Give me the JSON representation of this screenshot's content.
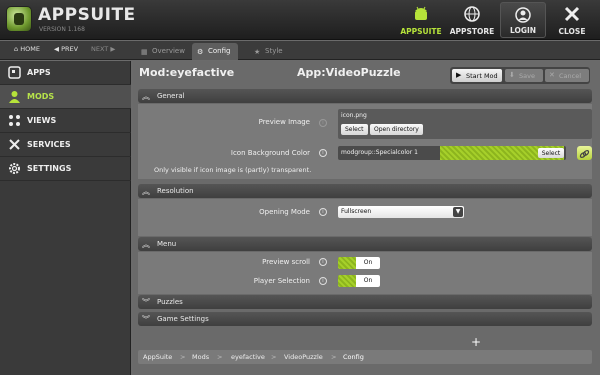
{
  "app": {
    "title": "APPSUITE",
    "version": "VERSION 1.168"
  },
  "top_buttons": [
    {
      "label": "APPSUITE",
      "icon": "android-icon"
    },
    {
      "label": "APPSTORE",
      "icon": "globe-icon"
    },
    {
      "label": "LOGIN",
      "icon": "user-icon"
    },
    {
      "label": "CLOSE",
      "icon": "close-icon"
    }
  ],
  "nav": {
    "home": "HOME",
    "prev": "PREV",
    "next": "NEXT"
  },
  "tabs": [
    {
      "label": "Overview",
      "icon": "grid-icon"
    },
    {
      "label": "Config",
      "icon": "gear-icon"
    },
    {
      "label": "Style",
      "icon": "star-icon"
    }
  ],
  "sidebar": {
    "items": [
      {
        "label": "APPS",
        "icon": "apps-icon"
      },
      {
        "label": "MODS",
        "icon": "user-icon"
      },
      {
        "label": "VIEWS",
        "icon": "grid-icon"
      },
      {
        "label": "SERVICES",
        "icon": "tools-icon"
      },
      {
        "label": "SETTINGS",
        "icon": "gear-icon"
      }
    ]
  },
  "header": {
    "mod_prefix": "Mod:",
    "mod_name": "eyefactive",
    "app_prefix": "App:",
    "app_name": "VideoPuzzle",
    "start_label": "Start Mod",
    "save_label": "Save",
    "cancel_label": "Cancel"
  },
  "sections": {
    "general": "General",
    "resolution": "Resolution",
    "menu": "Menu",
    "puzzles": "Puzzles",
    "game_settings": "Game Settings"
  },
  "general": {
    "preview_image_label": "Preview Image",
    "preview_image_file": "icon.png",
    "select_label": "Select",
    "open_directory_label": "Open directory",
    "bg_color_label": "Icon Background Color",
    "bg_color_value": "modgroup::Specialcolor 1",
    "bg_select_label": "Select",
    "hint": "Only visible if icon image is (partly) transparent."
  },
  "resolution": {
    "opening_mode_label": "Opening Mode",
    "opening_mode_value": "Fullscreen"
  },
  "menu": {
    "preview_scroll_label": "Preview scroll",
    "preview_scroll_value": "On",
    "player_selection_label": "Player Selection",
    "player_selection_value": "On"
  },
  "breadcrumb": [
    "AppSuite",
    "Mods",
    "eyefactive",
    "VideoPuzzle",
    "Config"
  ],
  "colors": {
    "accent": "#b6e33a",
    "background": "#6b6b6b",
    "sidebar": "#3a3a3a"
  }
}
